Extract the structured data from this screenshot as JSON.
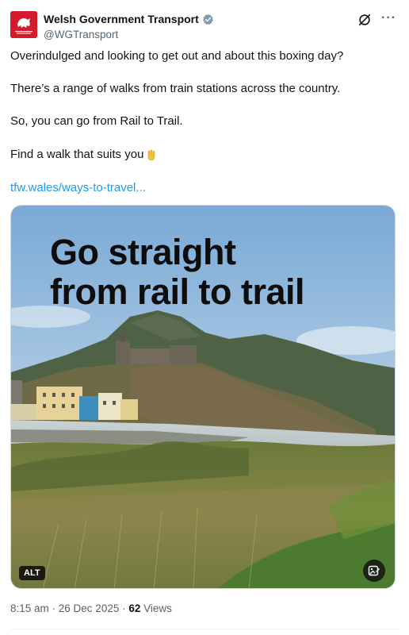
{
  "author": {
    "display_name": "Welsh Government Transport",
    "handle": "@WGTransport",
    "avatar_logo_text": "Llywodraeth Cymru Welsh Government",
    "verified": true
  },
  "tweet": {
    "line1": "Overindulged and looking to get out and about this boxing day?",
    "line2": "There’s a range of walks from train stations across the country.",
    "line3": "So, you can go from Rail to Trail.",
    "line4": "Find a walk that suits you",
    "emoji": "pointing-down-emoji",
    "link": "tfw.wales/ways-to-travel..."
  },
  "media": {
    "headline_line1": "Go straight",
    "headline_line2": "from rail to trail",
    "alt_badge": "ALT"
  },
  "meta": {
    "time": "8:15 am",
    "separator1": " · ",
    "date": "26 Dec 2025",
    "separator2": " · ",
    "views_count": "62",
    "views_label": " Views"
  },
  "icons": {
    "grok": "grok-icon",
    "more": "more-icon",
    "edit_image": "image-edit-icon",
    "verified": "verified-badge-icon"
  },
  "colors": {
    "link": "#1d9bf0",
    "secondary_text": "#536471",
    "avatar_red": "#d21b2b",
    "verified_gray": "#829aab"
  }
}
